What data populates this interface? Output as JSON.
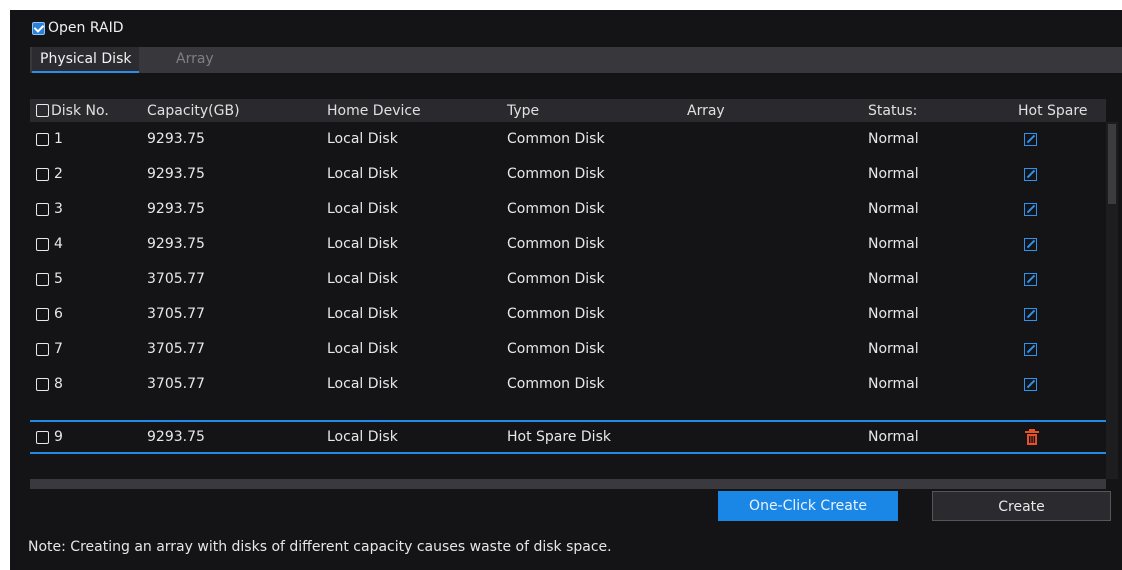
{
  "open_raid": {
    "label": "Open RAID",
    "checked": true
  },
  "tabs": [
    {
      "label": "Physical Disk",
      "active": true
    },
    {
      "label": "Array",
      "active": false
    }
  ],
  "table": {
    "headers": {
      "disk_no": "Disk No.",
      "capacity": "Capacity(GB)",
      "home_device": "Home Device",
      "type": "Type",
      "array": "Array",
      "status": "Status:",
      "hot_spare": "Hot Spare"
    },
    "rows": [
      {
        "disk_no": "1",
        "capacity": "9293.75",
        "home_device": "Local Disk",
        "type": "Common Disk",
        "array": "",
        "status": "Normal",
        "action_icon": "edit-icon"
      },
      {
        "disk_no": "2",
        "capacity": "9293.75",
        "home_device": "Local Disk",
        "type": "Common Disk",
        "array": "",
        "status": "Normal",
        "action_icon": "edit-icon"
      },
      {
        "disk_no": "3",
        "capacity": "9293.75",
        "home_device": "Local Disk",
        "type": "Common Disk",
        "array": "",
        "status": "Normal",
        "action_icon": "edit-icon"
      },
      {
        "disk_no": "4",
        "capacity": "9293.75",
        "home_device": "Local Disk",
        "type": "Common Disk",
        "array": "",
        "status": "Normal",
        "action_icon": "edit-icon"
      },
      {
        "disk_no": "5",
        "capacity": "3705.77",
        "home_device": "Local Disk",
        "type": "Common Disk",
        "array": "",
        "status": "Normal",
        "action_icon": "edit-icon"
      },
      {
        "disk_no": "6",
        "capacity": "3705.77",
        "home_device": "Local Disk",
        "type": "Common Disk",
        "array": "",
        "status": "Normal",
        "action_icon": "edit-icon"
      },
      {
        "disk_no": "7",
        "capacity": "3705.77",
        "home_device": "Local Disk",
        "type": "Common Disk",
        "array": "",
        "status": "Normal",
        "action_icon": "edit-icon"
      },
      {
        "disk_no": "8",
        "capacity": "3705.77",
        "home_device": "Local Disk",
        "type": "Common Disk",
        "array": "",
        "status": "Normal",
        "action_icon": "edit-icon"
      },
      {
        "disk_no": "9",
        "capacity": "9293.75",
        "home_device": "Local Disk",
        "type": "Hot Spare Disk",
        "array": "",
        "status": "Normal",
        "action_icon": "trash-icon",
        "selected": true
      }
    ]
  },
  "buttons": {
    "one_click_create": "One-Click Create",
    "create": "Create"
  },
  "note": "Note: Creating an array with disks of different capacity causes waste of disk space.",
  "colors": {
    "accent": "#1a86e6",
    "edit_icon": "#2d93ee",
    "trash_icon": "#e8502a",
    "background": "#141416"
  }
}
